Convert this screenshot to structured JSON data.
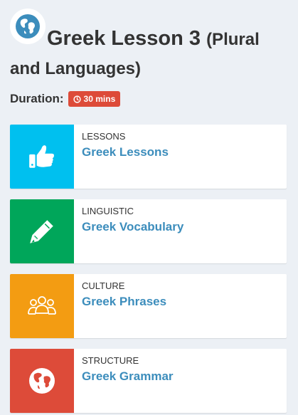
{
  "lesson": {
    "title_main": "Greek Lesson 3",
    "title_paren_part1": "(Plural",
    "title_paren_part2": "and Languages)",
    "duration_label": "Duration:",
    "duration_value": "30 mins"
  },
  "cards": [
    {
      "category": "LESSONS",
      "title": "Greek Lessons",
      "color": "#00c0ef",
      "icon": "thumbs-up-icon"
    },
    {
      "category": "LINGUISTIC",
      "title": "Greek Vocabulary",
      "color": "#00a65a",
      "icon": "pencil-icon"
    },
    {
      "category": "CULTURE",
      "title": "Greek Phrases",
      "color": "#f39c12",
      "icon": "people-icon"
    },
    {
      "category": "STRUCTURE",
      "title": "Greek Grammar",
      "color": "#dd4b39",
      "icon": "globe-icon"
    }
  ]
}
